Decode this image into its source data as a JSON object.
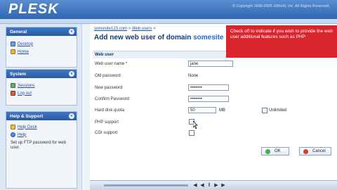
{
  "header": {
    "logo": "PLESK",
    "copyright": "© Copyright 1999-2005 SWsoft, Inc. All Rights Reserved."
  },
  "sidebar": {
    "general": {
      "title": "General",
      "items": [
        {
          "label": "Desktop",
          "icon": "desktop-icon"
        },
        {
          "label": "Home",
          "icon": "home-icon"
        }
      ]
    },
    "system": {
      "title": "System",
      "items": [
        {
          "label": "Sessions",
          "icon": "sessions-icon"
        },
        {
          "label": "Log out",
          "icon": "logout-icon"
        }
      ]
    },
    "help": {
      "title": "Help & Support",
      "items": [
        {
          "label": "Help Desk",
          "icon": "helpdesk-icon"
        },
        {
          "label": "Help",
          "icon": "help-icon"
        }
      ],
      "note": "Set up FTP password for web user."
    }
  },
  "main": {
    "breadcrumb": {
      "domain": "somesite123.com",
      "sep": ">",
      "section": "Web users",
      "tail": ">"
    },
    "title_prefix": "Add new web user of domain ",
    "title_domain": "somesite",
    "section_label": "Web user",
    "rows": {
      "username_label": "Web user name *",
      "username_value": "jane",
      "old_password_label": "Old password",
      "old_password_value": "None",
      "new_password_label": "New password",
      "new_password_value": "••••••••",
      "confirm_label": "Confirm Password",
      "confirm_value": "••••••••",
      "quota_label": "Hard disk quota",
      "quota_value": "50",
      "quota_unit": "MB",
      "unlimited_label": "Unlimited",
      "php_label": "PHP support",
      "cgi_label": "CGI support"
    },
    "buttons": {
      "ok": "OK",
      "cancel": "Cancel"
    }
  },
  "tooltip": {
    "text": "Check off to indicate if you wish to provide the web user additional features such as PHP"
  },
  "colors": {
    "header": "#2f66b3",
    "tooltip": "#d9262c",
    "accent": "#2a6ac1"
  }
}
